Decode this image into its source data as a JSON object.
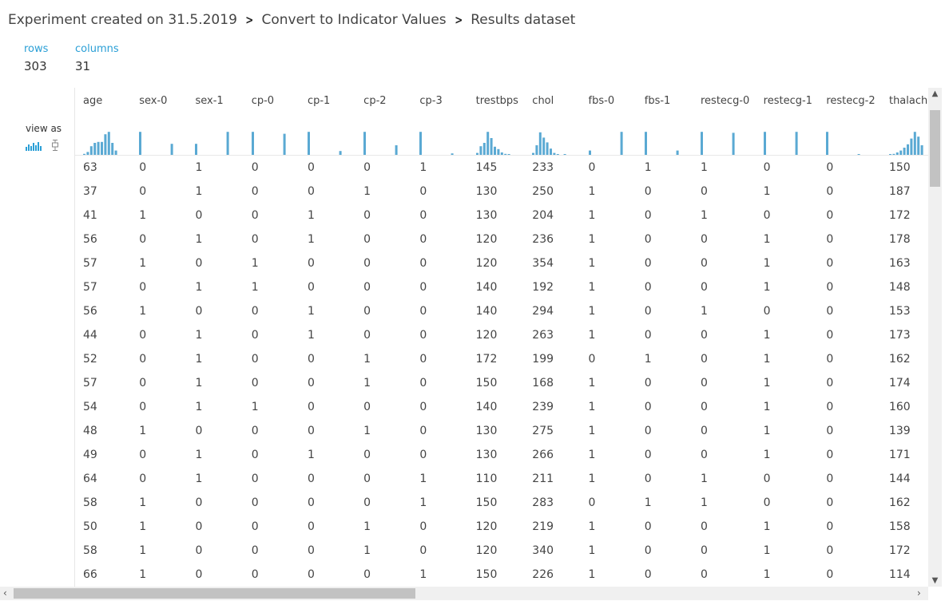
{
  "breadcrumb": {
    "items": [
      "Experiment created on 31.5.2019",
      "Convert to Indicator Values",
      "Results dataset"
    ]
  },
  "stats": {
    "rows_label": "rows",
    "rows_value": "303",
    "columns_label": "columns",
    "columns_value": "31"
  },
  "view_as": {
    "label": "view as",
    "icons": [
      "histogram-icon",
      "boxplot-icon"
    ]
  },
  "colors": {
    "accent": "#2a9fd6",
    "bar": "#5aa9d3"
  },
  "table": {
    "columns": [
      "age",
      "sex-0",
      "sex-1",
      "cp-0",
      "cp-1",
      "cp-2",
      "cp-3",
      "trestbps",
      "chol",
      "fbs-0",
      "fbs-1",
      "restecg-0",
      "restecg-1",
      "restecg-2",
      "thalach"
    ],
    "rows": [
      [
        "63",
        "0",
        "1",
        "0",
        "0",
        "0",
        "1",
        "145",
        "233",
        "0",
        "1",
        "1",
        "0",
        "0",
        "150"
      ],
      [
        "37",
        "0",
        "1",
        "0",
        "0",
        "1",
        "0",
        "130",
        "250",
        "1",
        "0",
        "0",
        "1",
        "0",
        "187"
      ],
      [
        "41",
        "1",
        "0",
        "0",
        "1",
        "0",
        "0",
        "130",
        "204",
        "1",
        "0",
        "1",
        "0",
        "0",
        "172"
      ],
      [
        "56",
        "0",
        "1",
        "0",
        "1",
        "0",
        "0",
        "120",
        "236",
        "1",
        "0",
        "0",
        "1",
        "0",
        "178"
      ],
      [
        "57",
        "1",
        "0",
        "1",
        "0",
        "0",
        "0",
        "120",
        "354",
        "1",
        "0",
        "0",
        "1",
        "0",
        "163"
      ],
      [
        "57",
        "0",
        "1",
        "1",
        "0",
        "0",
        "0",
        "140",
        "192",
        "1",
        "0",
        "0",
        "1",
        "0",
        "148"
      ],
      [
        "56",
        "1",
        "0",
        "0",
        "1",
        "0",
        "0",
        "140",
        "294",
        "1",
        "0",
        "1",
        "0",
        "0",
        "153"
      ],
      [
        "44",
        "0",
        "1",
        "0",
        "1",
        "0",
        "0",
        "120",
        "263",
        "1",
        "0",
        "0",
        "1",
        "0",
        "173"
      ],
      [
        "52",
        "0",
        "1",
        "0",
        "0",
        "1",
        "0",
        "172",
        "199",
        "0",
        "1",
        "0",
        "1",
        "0",
        "162"
      ],
      [
        "57",
        "0",
        "1",
        "0",
        "0",
        "1",
        "0",
        "150",
        "168",
        "1",
        "0",
        "0",
        "1",
        "0",
        "174"
      ],
      [
        "54",
        "0",
        "1",
        "1",
        "0",
        "0",
        "0",
        "140",
        "239",
        "1",
        "0",
        "0",
        "1",
        "0",
        "160"
      ],
      [
        "48",
        "1",
        "0",
        "0",
        "0",
        "1",
        "0",
        "130",
        "275",
        "1",
        "0",
        "0",
        "1",
        "0",
        "139"
      ],
      [
        "49",
        "0",
        "1",
        "0",
        "1",
        "0",
        "0",
        "130",
        "266",
        "1",
        "0",
        "0",
        "1",
        "0",
        "171"
      ],
      [
        "64",
        "0",
        "1",
        "0",
        "0",
        "0",
        "1",
        "110",
        "211",
        "1",
        "0",
        "1",
        "0",
        "0",
        "144"
      ],
      [
        "58",
        "1",
        "0",
        "0",
        "0",
        "0",
        "1",
        "150",
        "283",
        "0",
        "1",
        "1",
        "0",
        "0",
        "162"
      ],
      [
        "50",
        "1",
        "0",
        "0",
        "0",
        "1",
        "0",
        "120",
        "219",
        "1",
        "0",
        "0",
        "1",
        "0",
        "158"
      ],
      [
        "58",
        "1",
        "0",
        "0",
        "0",
        "1",
        "0",
        "120",
        "340",
        "1",
        "0",
        "0",
        "1",
        "0",
        "172"
      ],
      [
        "66",
        "1",
        "0",
        "0",
        "0",
        "0",
        "1",
        "150",
        "226",
        "1",
        "0",
        "0",
        "1",
        "0",
        "114"
      ]
    ],
    "histograms": [
      [
        0.04,
        0.12,
        0.36,
        0.5,
        0.54,
        0.54,
        0.86,
        0.96,
        0.5,
        0.18
      ],
      [
        0.96,
        0,
        0,
        0,
        0,
        0,
        0,
        0,
        0,
        0.46
      ],
      [
        0.46,
        0,
        0,
        0,
        0,
        0,
        0,
        0,
        0,
        0.96
      ],
      [
        0.96,
        0,
        0,
        0,
        0,
        0,
        0,
        0,
        0,
        0.88
      ],
      [
        0.96,
        0,
        0,
        0,
        0,
        0,
        0,
        0,
        0,
        0.16
      ],
      [
        0.96,
        0,
        0,
        0,
        0,
        0,
        0,
        0,
        0,
        0.4
      ],
      [
        0.96,
        0,
        0,
        0,
        0,
        0,
        0,
        0,
        0,
        0.06
      ],
      [
        0.08,
        0.36,
        0.5,
        0.96,
        0.7,
        0.34,
        0.24,
        0.1,
        0.04,
        0.02
      ],
      [
        0.08,
        0.4,
        0.94,
        0.72,
        0.52,
        0.26,
        0.08,
        0.02,
        0,
        0.02
      ],
      [
        0.18,
        0,
        0,
        0,
        0,
        0,
        0,
        0,
        0,
        0.96
      ],
      [
        0.96,
        0,
        0,
        0,
        0,
        0,
        0,
        0,
        0,
        0.18
      ],
      [
        0.96,
        0,
        0,
        0,
        0,
        0,
        0,
        0,
        0,
        0.92
      ],
      [
        0.96,
        0,
        0,
        0,
        0,
        0,
        0,
        0,
        0,
        0.96
      ],
      [
        0.96,
        0,
        0,
        0,
        0,
        0,
        0,
        0,
        0,
        0.03
      ],
      [
        0.02,
        0.04,
        0.1,
        0.18,
        0.3,
        0.44,
        0.68,
        0.96,
        0.76,
        0.4
      ]
    ]
  }
}
